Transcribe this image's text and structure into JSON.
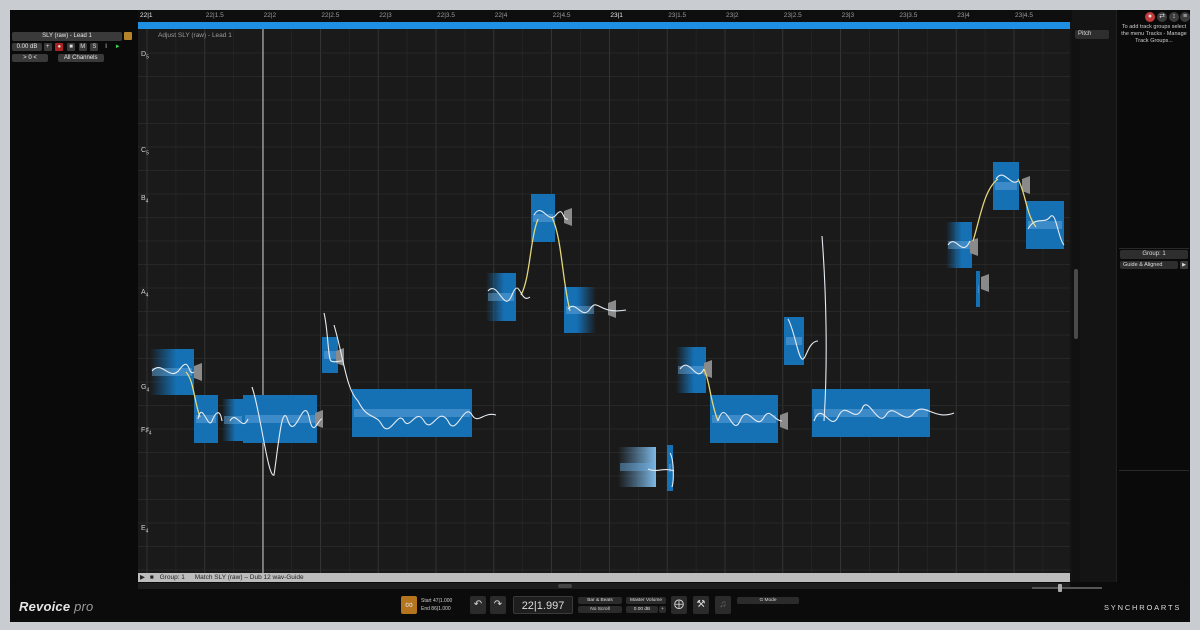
{
  "track": {
    "name": "SLY (raw) - Lead 1",
    "volume": "0.00 dB",
    "pan": "> 0 <",
    "channels": "All Channels",
    "buttons": {
      "mute": "M",
      "solo": "S",
      "input": "I"
    }
  },
  "ruler": {
    "labels": [
      "22|1",
      "22|1.5",
      "22|2",
      "22|2.5",
      "22|3",
      "22|3.5",
      "22|4",
      "22|4.5",
      "23|1",
      "23|1.5",
      "23|2",
      "23|2.5",
      "23|3",
      "23|3.5",
      "23|4",
      "23|4.5"
    ],
    "major": [
      "22|1",
      "23|1"
    ]
  },
  "lane_label": "Adjust SLY (raw) - Lead 1",
  "note_labels": [
    {
      "text": "D",
      "octave": "5"
    },
    {
      "text": "C",
      "octave": "5"
    },
    {
      "text": "B",
      "octave": "4"
    },
    {
      "text": "A",
      "octave": "4"
    },
    {
      "text": "G",
      "octave": "4"
    },
    {
      "text": "F♯",
      "octave": "4"
    },
    {
      "text": "E",
      "octave": "4"
    }
  ],
  "editor_footer": {
    "group": "Group: 1",
    "match_text": "Match SLY (raw) – Dub 12 wav-Guide"
  },
  "pitch_dropdown": "Pitch",
  "right_panel": {
    "hint": "To add track groups select the menu Tracks - Manage Track Groups...",
    "group": "Group: 1",
    "guide": "Guide & Aligned"
  },
  "transport": {
    "start_label": "Start",
    "start_value": "47|1.000",
    "end_label": "End",
    "end_value": "86|1.000",
    "position": "22|1.997",
    "bar_beats": "Bar & Beats",
    "no_scroll": "No Scroll",
    "master_volume_label": "Master Volume",
    "master_volume_value": "0.00 dB",
    "mode_dropdown": "G Mode"
  },
  "branding": {
    "app_name": "Revoice",
    "app_suffix": "pro",
    "company": "SYNCHROARTS"
  },
  "colors": {
    "accent_blue": "#1e8fe4",
    "blob_blue": "#1670b4",
    "pitch_curve": "#e6ecf2",
    "transition_curve": "#e3d77a",
    "background": "#1a1a1a"
  },
  "icons": [
    "lock-icon",
    "undo-icon",
    "redo-icon",
    "metronome-icon",
    "tools-icon",
    "target-icon",
    "help-icon"
  ]
}
